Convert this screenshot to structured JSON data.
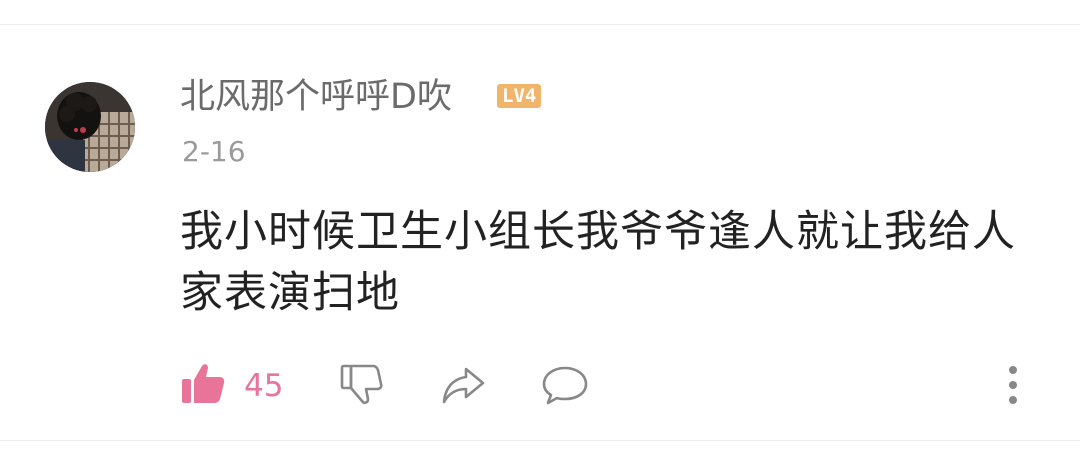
{
  "comment": {
    "username": "北风那个呼呼D吹",
    "level_badge": "LV4",
    "date": "2-16",
    "text": "我小时候卫生小组长我爷爷逢人就让我给人家表演扫地",
    "likes": "45"
  },
  "icons": {
    "like": "thumbs-up-icon",
    "dislike": "thumbs-down-icon",
    "share": "share-arrow-icon",
    "reply": "comment-bubble-icon",
    "more": "more-vertical-icon"
  },
  "colors": {
    "like_accent": "#e8749a",
    "badge": "#f1b46b",
    "username": "#6b6b6b",
    "date": "#9a9a9a",
    "text": "#222222",
    "icon_gray": "#888888"
  }
}
